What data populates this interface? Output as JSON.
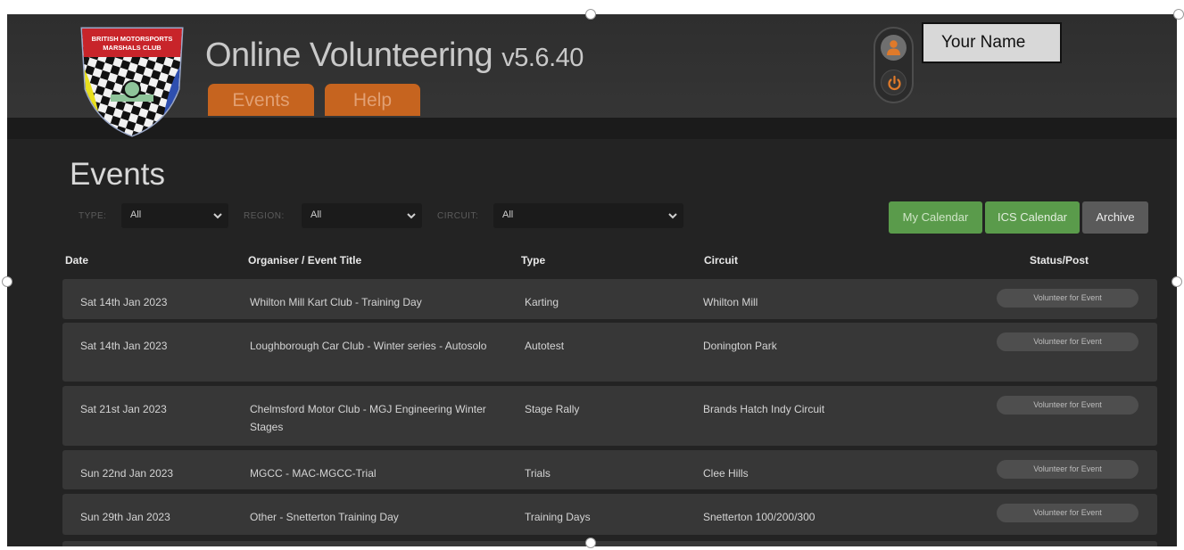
{
  "app": {
    "title": "Online Volunteering",
    "version": "v5.6.40",
    "logo_text_line1": "BRITISH MOTORSPORTS",
    "logo_text_line2": "MARSHALS CLUB"
  },
  "nav": {
    "tabs": [
      {
        "label": "Events"
      },
      {
        "label": "Help"
      }
    ]
  },
  "user": {
    "name": "Your Name"
  },
  "page": {
    "title": "Events"
  },
  "filters": {
    "type": {
      "label": "TYPE:",
      "value": "All"
    },
    "region": {
      "label": "REGION:",
      "value": "All"
    },
    "circuit": {
      "label": "CIRCUIT:",
      "value": "All"
    }
  },
  "buttons": {
    "my_calendar": "My Calendar",
    "ics_calendar": "ICS Calendar",
    "archive": "Archive"
  },
  "table": {
    "headers": {
      "date": "Date",
      "title": "Organiser / Event Title",
      "type": "Type",
      "circuit": "Circuit",
      "status": "Status/Post"
    },
    "rows": [
      {
        "date": "Sat 14th Jan 2023",
        "title": "Whilton Mill Kart Club - Training Day",
        "type": "Karting",
        "circuit": "Whilton Mill",
        "action": "Volunteer for Event"
      },
      {
        "date": "Sat 14th Jan 2023",
        "title": "Loughborough Car Club - Winter series - Autosolo",
        "type": "Autotest",
        "circuit": "Donington Park",
        "action": "Volunteer for Event"
      },
      {
        "date": "Sat 21st Jan 2023",
        "title": "Chelmsford Motor Club - MGJ Engineering Winter Stages",
        "type": "Stage Rally",
        "circuit": "Brands Hatch Indy Circuit",
        "action": "Volunteer for Event"
      },
      {
        "date": "Sun 22nd Jan 2023",
        "title": "MGCC - MAC-MGCC-Trial",
        "type": "Trials",
        "circuit": "Clee Hills",
        "action": "Volunteer for Event"
      },
      {
        "date": "Sun 29th Jan 2023",
        "title": "Other - Snetterton Training Day",
        "type": "Training Days",
        "circuit": "Snetterton 100/200/300",
        "action": "Volunteer for Event"
      }
    ]
  },
  "colors": {
    "accent_orange": "#c6641f",
    "calendar_green": "#5a9b4b",
    "archive_grey": "#5a5a5a",
    "background": "#232323"
  },
  "icons": {
    "user": "user-icon",
    "power": "power-icon",
    "dropdown": "chevron-down-icon"
  }
}
